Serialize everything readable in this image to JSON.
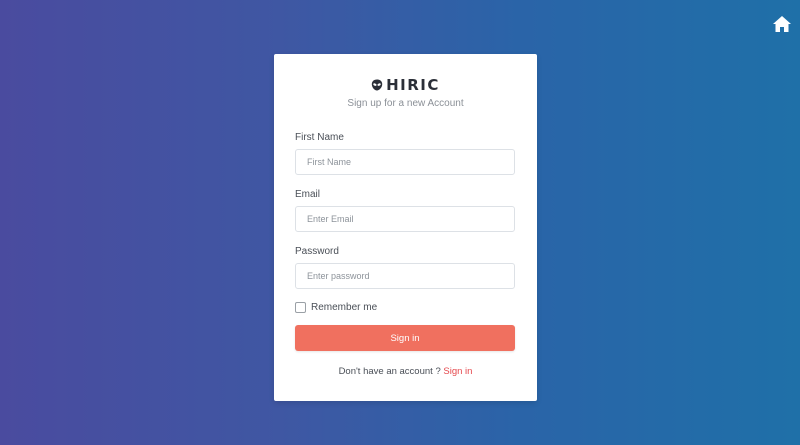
{
  "header": {
    "home_icon": "home-icon"
  },
  "brand": {
    "logo_icon": "alien-icon",
    "name": "HIRIC",
    "subtitle": "Sign up for a new Account"
  },
  "form": {
    "first_name": {
      "label": "First Name",
      "placeholder": "First Name",
      "value": ""
    },
    "email": {
      "label": "Email",
      "placeholder": "Enter Email",
      "value": ""
    },
    "password": {
      "label": "Password",
      "placeholder": "Enter password",
      "value": ""
    },
    "remember": {
      "label": "Remember me",
      "checked": false
    },
    "submit_label": "Sign in"
  },
  "footer": {
    "prompt": "Don't have an account ? ",
    "link_label": "Sign in"
  },
  "colors": {
    "background_gradient_start": "#4a4b9f",
    "background_gradient_end": "#1f70a8",
    "button": "#f0705f",
    "link": "#e5484d"
  }
}
